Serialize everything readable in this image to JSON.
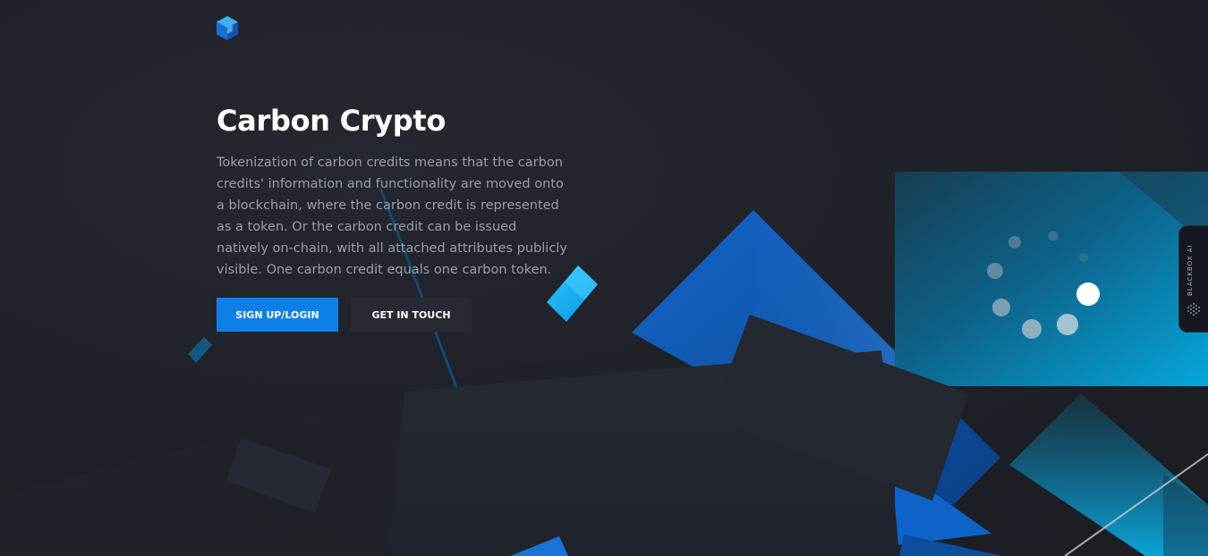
{
  "brand": {
    "logo_icon": "cube-icon",
    "accent": "#0f7fe8"
  },
  "hero": {
    "title": "Carbon Crypto",
    "description": "Tokenization of carbon credits means that the carbon credits' information and functionality are moved onto a blockchain, where the carbon credit is represented as a token. Or the carbon credit can be issued natively on-chain, with all attached attributes publicly visible. One carbon credit equals one carbon token."
  },
  "actions": {
    "primary_label": "SIGN UP/LOGIN",
    "secondary_label": "GET IN TOUCH"
  },
  "widget": {
    "label": "BLACKBOX AI",
    "icon": "dots-grid-icon"
  }
}
